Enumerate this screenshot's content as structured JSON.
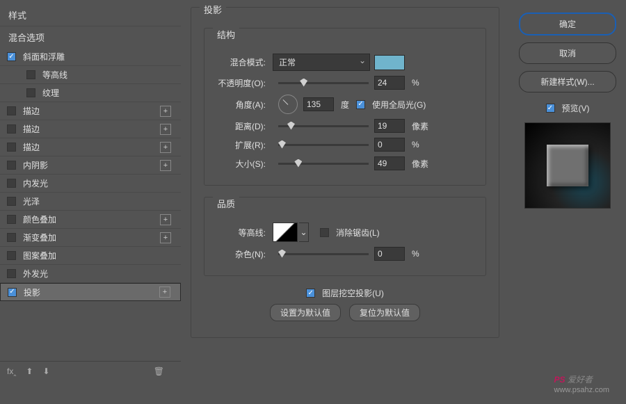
{
  "left": {
    "header1": "样式",
    "header2": "混合选项",
    "items": [
      {
        "label": "斜面和浮雕",
        "checked": true,
        "plus": false,
        "sub": false
      },
      {
        "label": "等高线",
        "checked": false,
        "plus": false,
        "sub": true
      },
      {
        "label": "纹理",
        "checked": false,
        "plus": false,
        "sub": true
      },
      {
        "label": "描边",
        "checked": false,
        "plus": true,
        "sub": false
      },
      {
        "label": "描边",
        "checked": false,
        "plus": true,
        "sub": false
      },
      {
        "label": "描边",
        "checked": false,
        "plus": true,
        "sub": false
      },
      {
        "label": "内阴影",
        "checked": false,
        "plus": true,
        "sub": false
      },
      {
        "label": "内发光",
        "checked": false,
        "plus": false,
        "sub": false
      },
      {
        "label": "光泽",
        "checked": false,
        "plus": false,
        "sub": false
      },
      {
        "label": "颜色叠加",
        "checked": false,
        "plus": true,
        "sub": false
      },
      {
        "label": "渐变叠加",
        "checked": false,
        "plus": true,
        "sub": false
      },
      {
        "label": "图案叠加",
        "checked": false,
        "plus": false,
        "sub": false
      },
      {
        "label": "外发光",
        "checked": false,
        "plus": false,
        "sub": false
      },
      {
        "label": "投影",
        "checked": true,
        "plus": true,
        "sub": false,
        "selected": true
      }
    ],
    "footer_fx": "fx‸",
    "footer_up": "⬆",
    "footer_down": "⬇",
    "footer_trash": "🗑"
  },
  "main": {
    "title": "投影",
    "structure": {
      "title": "结构",
      "blend_label": "混合模式:",
      "blend_value": "正常",
      "opacity_label": "不透明度(O):",
      "opacity_value": "24",
      "opacity_unit": "%",
      "angle_label": "角度(A):",
      "angle_value": "135",
      "angle_unit": "度",
      "global_light": "使用全局光(G)",
      "distance_label": "距离(D):",
      "distance_value": "19",
      "distance_unit": "像素",
      "spread_label": "扩展(R):",
      "spread_value": "0",
      "spread_unit": "%",
      "size_label": "大小(S):",
      "size_value": "49",
      "size_unit": "像素"
    },
    "quality": {
      "title": "品质",
      "contour_label": "等高线:",
      "antialias": "消除锯齿(L)",
      "noise_label": "杂色(N):",
      "noise_value": "0",
      "noise_unit": "%"
    },
    "knockout": "图层挖空投影(U)",
    "btn_default": "设置为默认值",
    "btn_reset": "复位为默认值"
  },
  "right": {
    "ok": "确定",
    "cancel": "取消",
    "new_style": "新建样式(W)...",
    "preview": "预览(V)"
  },
  "watermark": {
    "brand": "PS 爱好者",
    "url": "www.psahz.com"
  }
}
